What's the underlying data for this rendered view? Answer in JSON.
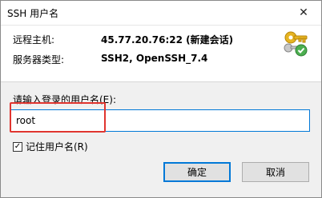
{
  "window": {
    "title": "SSH 用户名",
    "close_icon": "close-icon"
  },
  "info": {
    "remote_host_label": "远程主机:",
    "remote_host_value": "45.77.20.76:22 (新建会话)",
    "server_type_label": "服务器类型:",
    "server_type_value": "SSH2, OpenSSH_7.4",
    "icon": "keys-icon"
  },
  "form": {
    "prompt": "请输入登录的用户名(E):",
    "username_value": "root",
    "remember_label": "记住用户名(R)",
    "remember_checked": true
  },
  "buttons": {
    "ok": "确定",
    "cancel": "取消"
  },
  "colors": {
    "accent": "#0078d7",
    "highlight": "#e0352f",
    "key_gold": "#e6b422",
    "check_green": "#4caf50"
  }
}
